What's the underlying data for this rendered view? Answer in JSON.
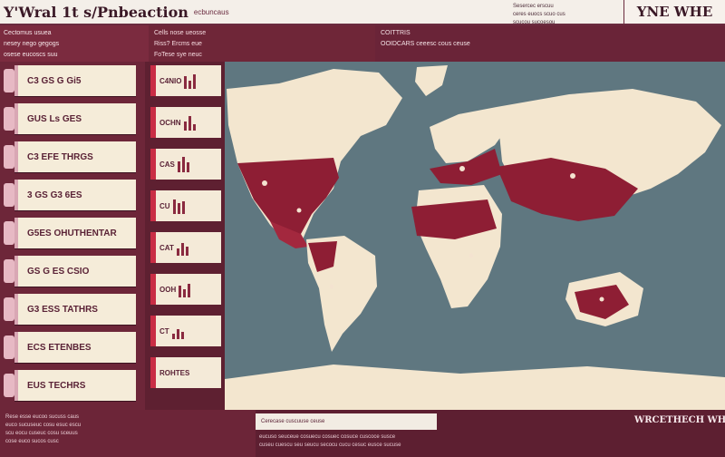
{
  "header": {
    "title": "Y'Wral 1t s/Pnbeaction",
    "subtitle": "ecbuncaus",
    "meta_lines": [
      "Sesercec erscuu",
      "ceres euocs scuo cus",
      "scucou sucoesou"
    ],
    "brand": "YNE WHE"
  },
  "bands": {
    "left": [
      "Cectomus usuea",
      "nesey nego gegogs",
      "osese eucoscs suu"
    ],
    "mid": [
      "Cells nose ueosse",
      "Riss? Ercms eue",
      "FoTese sye neuc"
    ],
    "right": [
      "COITTRIS",
      "OOIDCARS ceeesc cous ceuse"
    ]
  },
  "left_cards": [
    {
      "label": "C3 GS  G Gi5"
    },
    {
      "label": "GUS Ls  GES"
    },
    {
      "label": "C3 EFE THRGS"
    },
    {
      "label": "3 GS  G3 6ES"
    },
    {
      "label": "G5ES OHUTHENTAR"
    },
    {
      "label": "GS G  ES CSIO"
    },
    {
      "label": "G3 ESS TATHRS"
    },
    {
      "label": "ECS ETENBES"
    },
    {
      "label": "EUS  TECHRS"
    }
  ],
  "mid_cards": [
    {
      "label": "C4NIO"
    },
    {
      "label": "OCHN"
    },
    {
      "label": "CAS"
    },
    {
      "label": "CU"
    },
    {
      "label": "CAT"
    },
    {
      "label": "OOH"
    },
    {
      "label": "CT"
    },
    {
      "label": "ROHTES"
    }
  ],
  "footer": {
    "left_lines": [
      "Rese esse eucoo sucuss caus",
      "euco sucuseuc cosu esuc escu",
      "scu eocu cuseuc cosu sceuus",
      "cose euco sucos cusc"
    ],
    "mid": "Cerecase cuscuuse ceuse",
    "lines": [
      "eucuso seuceue cosuecu cosuec cosuce cuscoce susce",
      "cuseu cuescu seu seucu secocu cucu cesuc eusce sucuse"
    ],
    "badge": "WRCETHECH WHE"
  },
  "colors": {
    "accent": "#7b2b3f",
    "ocean": "#5f7780",
    "land": "#f3e6cf",
    "highlight": "#8e1e34"
  }
}
